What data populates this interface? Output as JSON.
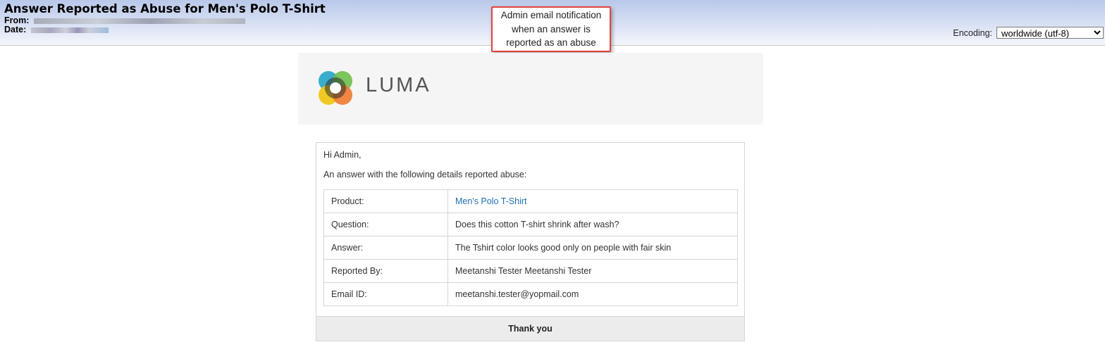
{
  "email": {
    "subject": "Answer Reported as Abuse for Men's Polo T-Shirt",
    "from_label": "From:",
    "date_label": "Date:"
  },
  "encoding": {
    "label": "Encoding:",
    "selected": "worldwide (utf-8)"
  },
  "callout": {
    "lines": [
      "Admin email notification",
      "when an answer is",
      "reported as an abuse"
    ]
  },
  "brand": {
    "name": "LUMA",
    "colors": {
      "teal": "#2aa6c8",
      "green": "#6fbf4b",
      "yellow": "#f1c40f",
      "orange": "#f07a31",
      "dark": "#2c2c2c"
    }
  },
  "body": {
    "greeting": "Hi Admin,",
    "intro": "An answer with the following details reported abuse:",
    "rows": [
      {
        "label": "Product:",
        "value": "Men's Polo T-Shirt"
      },
      {
        "label": "Question:",
        "value": "Does this cotton T-shirt shrink after wash?"
      },
      {
        "label": "Answer:",
        "value": "The Tshirt color looks good only on people with fair skin"
      },
      {
        "label": "Reported By:",
        "value": "Meetanshi Tester Meetanshi Tester"
      },
      {
        "label": "Email ID:",
        "value": "meetanshi.tester@yopmail.com"
      }
    ],
    "footer": "Thank you"
  }
}
